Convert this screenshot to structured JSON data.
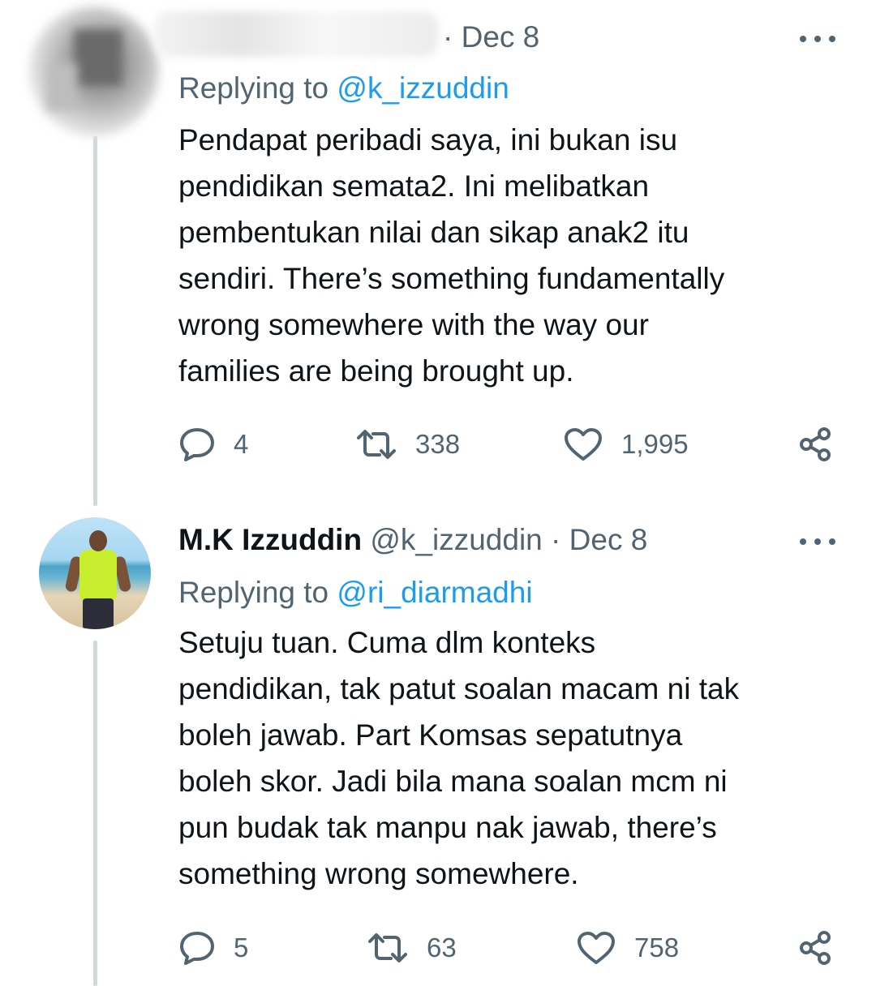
{
  "tweets": [
    {
      "display_name": "",
      "handle": "",
      "date": "Dec 8",
      "replying_label": "Replying to",
      "replying_to": "@k_izzuddin",
      "text_lines": [
        "Pendapat peribadi saya, ini bukan isu",
        "pendidikan semata2. Ini melibatkan",
        "pembentukan nilai dan sikap anak2 itu",
        "sendiri. There’s something fundamentally",
        "wrong somewhere with the way our",
        "families are being brought up."
      ],
      "replies": "4",
      "retweets": "338",
      "likes": "1,995"
    },
    {
      "display_name": "M.K Izzuddin",
      "handle": "@k_izzuddin",
      "date": "Dec 8",
      "replying_label": "Replying to",
      "replying_to": "@ri_diarmadhi",
      "text_lines": [
        "Setuju tuan. Cuma dlm konteks",
        "pendidikan, tak patut soalan macam ni tak",
        "boleh jawab. Part Komsas sepatutnya",
        "boleh skor. Jadi bila mana soalan mcm ni",
        "pun budak tak manpu nak jawab, there’s",
        "something wrong somewhere."
      ],
      "replies": "5",
      "retweets": "63",
      "likes": "758"
    }
  ],
  "separator": "·",
  "icons": {
    "more": "more-horizontal-icon",
    "reply": "reply-icon",
    "retweet": "retweet-icon",
    "like": "heart-icon",
    "share": "share-icon"
  },
  "colors": {
    "text": "#0f1419",
    "muted": "#536471",
    "link": "#1d9bf0",
    "thread_line": "#cfd9de"
  }
}
